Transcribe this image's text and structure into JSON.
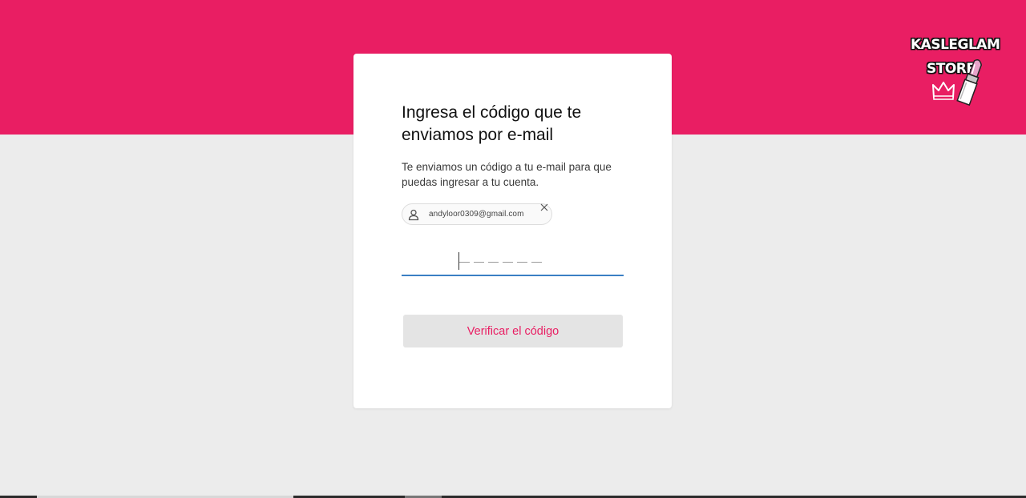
{
  "brand": {
    "logo_line1": "KASLEGLAM",
    "logo_line2": "STORE",
    "primary_color": "#e91e63",
    "background_color": "#ececec"
  },
  "card": {
    "title": "Ingresa el código que te enviamos por e-mail",
    "subtitle": "Te enviamos un código a tu e-mail para que puedas ingresar a tu cuenta.",
    "email_chip": {
      "avatar_icon": "user-icon",
      "email": "andyloor0309@gmail.com",
      "close_icon": "close-icon"
    },
    "code_input": {
      "value": "",
      "length": 6,
      "focus_color": "#3b7fc4"
    },
    "verify_button": {
      "label": "Verificar el código",
      "text_color": "#e91e63"
    }
  }
}
